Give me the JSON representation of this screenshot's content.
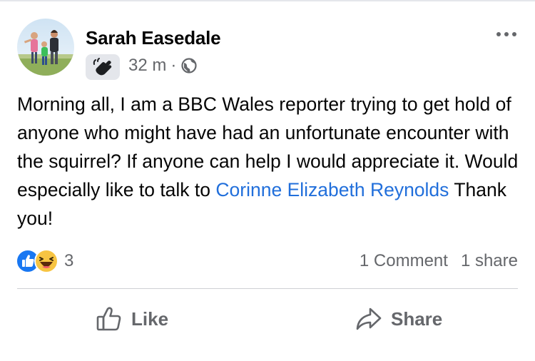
{
  "post": {
    "author": "Sarah Easedale",
    "time": "32 m",
    "separator": "·",
    "body_text": "Morning all, I am a BBC Wales reporter trying to get hold of anyone who might have had an unfortunate encounter with the squirrel? If anyone can help I would appreciate it. Would especially like to talk to",
    "mention": "Corinne Elizabeth Reynolds",
    "body_end": "Thank you!"
  },
  "engagement": {
    "reaction_count": "3",
    "comments": "1 Comment",
    "shares": "1 share"
  },
  "actions": {
    "like_label": "Like",
    "share_label": "Share"
  },
  "icons": {
    "more": "more-dots-icon",
    "wave": "waving-hand-icon",
    "privacy": "globe-icon",
    "like_reaction": "like-reaction-icon",
    "haha_reaction": "haha-reaction-icon",
    "like_action": "thumbs-up-icon",
    "share_action": "share-arrow-icon"
  },
  "colors": {
    "link_blue": "#216fdb",
    "meta_gray": "#65676b",
    "divider": "#ced0d4",
    "like_blue": "#1877f2",
    "haha_yellow": "#f7c442"
  }
}
